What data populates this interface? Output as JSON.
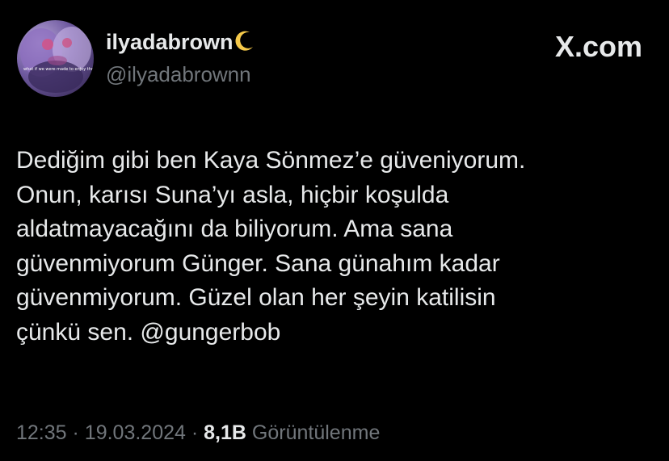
{
  "author": {
    "display_name": "ilyadabrown",
    "name_emoji": "crescent-moon-icon",
    "handle": "@ilyadabrownn",
    "avatar_caption": "what if we were made to enjoy the sin"
  },
  "brand": {
    "label": "X.com"
  },
  "tweet": {
    "lines": [
      "Dediğim gibi ben Kaya Sönmez’e güveniyorum.",
      "Onun, karısı Suna’yı asla, hiçbir koşulda",
      "aldatmayacağını da biliyorum. Ama sana",
      "güvenmiyorum Günger. Sana günahım kadar",
      "güvenmiyorum. Güzel olan her şeyin katilisin",
      "çünkü sen. @gungerbob"
    ]
  },
  "meta": {
    "time": "12:35",
    "separator": "·",
    "date": "19.03.2024",
    "views_count": "8,1B",
    "views_label": "Görüntülenme"
  },
  "colors": {
    "background": "#000000",
    "primary_text": "#e7e9ea",
    "secondary_text": "#71767b",
    "moon": "#f5c94a"
  }
}
